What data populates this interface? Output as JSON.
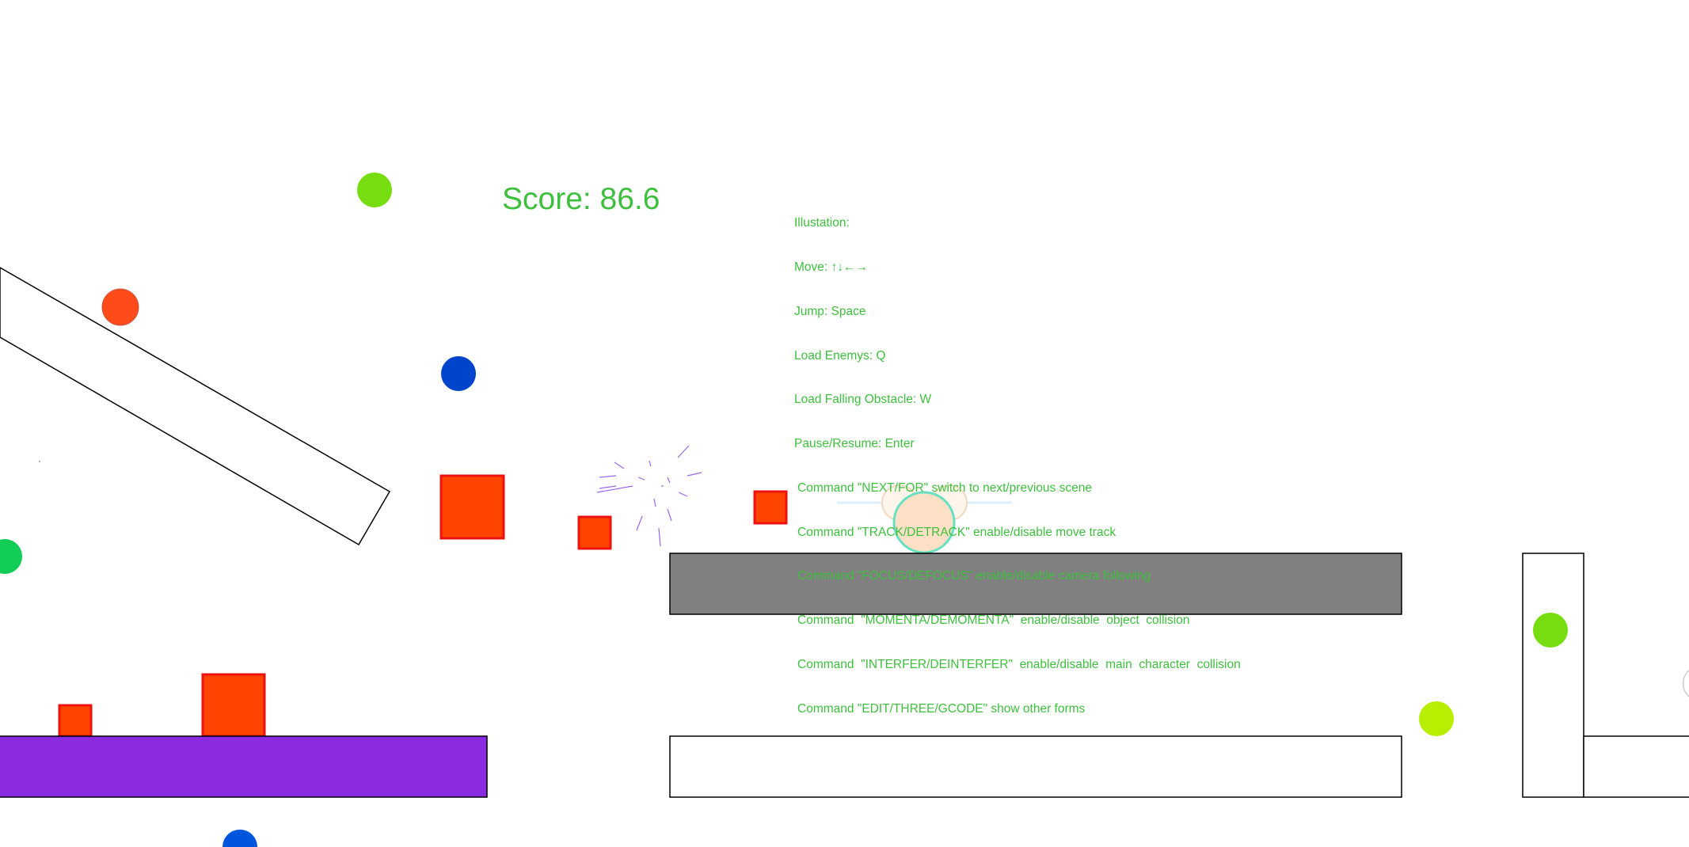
{
  "hud": {
    "score": "Score: 86.6",
    "instructions_title": "Illustation:",
    "controls": [
      "Move: ↑↓←→",
      "Jump: Space",
      "Load Enemys: Q",
      "Load Falling Obstacle: W",
      "Pause/Resume: Enter"
    ],
    "commands": [
      "Command \"NEXT/FOR\" switch to next/previous scene",
      "Command \"TRACK/DETRACK\" enable/disable move track",
      "Command \"FOCUS/DEFOCUS\" enable/disable camera following",
      "Command  \"MOMENTA/DEMOMENTA\"  enable/disable  object  collision",
      "Command  \"INTERFER/DEINTERFER\"  enable/disable  main  character  collision",
      "Command \"EDIT/THREE/GCODE\" show other forms"
    ]
  },
  "colors": {
    "hud_text": "#3ebf3e",
    "enemy_square_fill": "#ff4400",
    "enemy_square_border": "#ee1111",
    "platform_gray": "#808080",
    "platform_purple": "#8a2be2",
    "player_body": "#fde0c5",
    "player_outline": "#66e0c0",
    "ball_green": "#77dd11",
    "ball_lime": "#b8ee00",
    "ball_bright_green": "#11cc55",
    "ball_orange": "#ff4a1a",
    "ball_blue": "#0044cc",
    "ball_blue2": "#0055dd"
  },
  "icons": {
    "player": "bear-character-icon",
    "particles": "spark-burst-icon"
  }
}
